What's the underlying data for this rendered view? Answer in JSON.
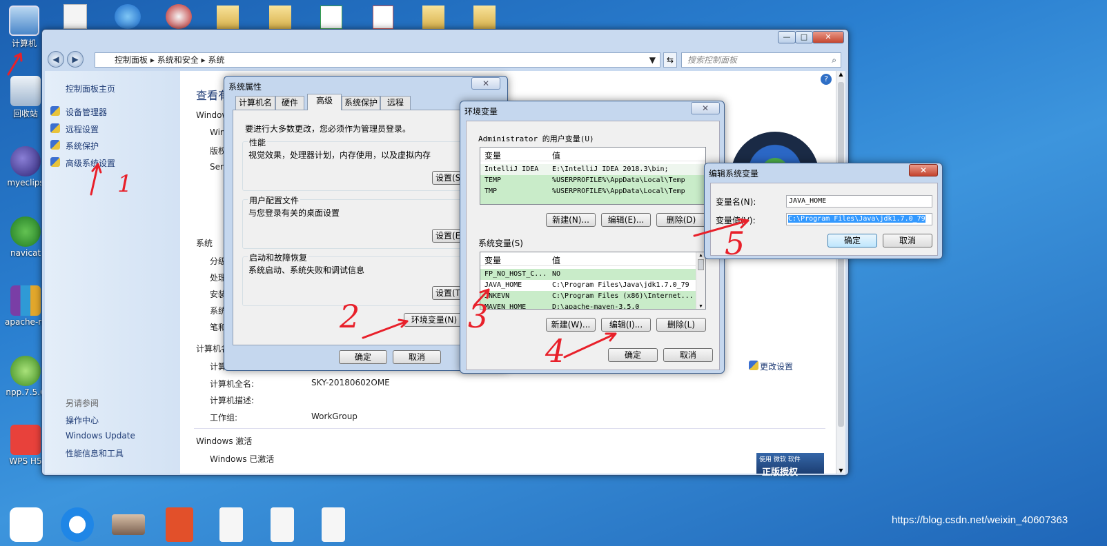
{
  "desktop": {
    "icons": [
      {
        "label": "计算机",
        "icon": "computer-icon"
      },
      {
        "label": "回收站",
        "icon": "recycle-bin-icon"
      },
      {
        "label": "myeclips",
        "icon": "eclipse-icon"
      },
      {
        "label": "navicat",
        "icon": "navicat-icon"
      },
      {
        "label": "apache-m",
        "icon": "archive-icon"
      },
      {
        "label": "npp.7.5.6",
        "icon": "notepad-icon"
      },
      {
        "label": "WPS H5",
        "icon": "wps-icon"
      }
    ],
    "watermark": "https://blog.csdn.net/weixin_40607363"
  },
  "explorer": {
    "breadcrumb": [
      "控制面板",
      "系统和安全",
      "系统"
    ],
    "search_placeholder": "搜索控制面板",
    "left_nav": {
      "home": "控制面板主页",
      "links": [
        "设备管理器",
        "远程设置",
        "系统保护",
        "高级系统设置"
      ],
      "see_also_title": "另请参阅",
      "see_also": [
        "操作中心",
        "Windows Update",
        "性能信息和工具"
      ]
    },
    "main": {
      "heading": "查看有",
      "section_windows": "Window",
      "windows_rows": [
        "Win",
        "版权",
        "Ser"
      ],
      "section_system": "系统",
      "system_rows": [
        "分级",
        "处理",
        "安装",
        "系统",
        "笔和"
      ],
      "section_computer": "计算机名",
      "computer_row": "计算",
      "full_name_label": "计算机全名:",
      "full_name_value": "SKY-20180602OME",
      "desc_label": "计算机描述:",
      "workgroup_label": "工作组:",
      "workgroup_value": "WorkGroup",
      "change_settings": "更改设置",
      "activation_section": "Windows 激活",
      "activation_status": "Windows 已激活",
      "genuine_line1": "使用 微软 软件",
      "genuine_line2": "正版授权"
    }
  },
  "sys_props": {
    "title": "系统属性",
    "tabs": [
      "计算机名",
      "硬件",
      "高级",
      "系统保护",
      "远程"
    ],
    "active_tab": "高级",
    "admin_note": "要进行大多数更改，您必须作为管理员登录。",
    "groups": [
      {
        "title": "性能",
        "desc": "视觉效果，处理器计划，内存使用，以及虚拟内存",
        "button": "设置(S"
      },
      {
        "title": "用户配置文件",
        "desc": "与您登录有关的桌面设置",
        "button": "设置(E"
      },
      {
        "title": "启动和故障恢复",
        "desc": "系统启动、系统失败和调试信息",
        "button": "设置(T"
      }
    ],
    "env_button": "环境变量(N)",
    "ok": "确定",
    "cancel": "取消"
  },
  "env_vars": {
    "title": "环境变量",
    "user_section": "Administrator 的用户变量(U)",
    "col_var": "变量",
    "col_val": "值",
    "user_rows": [
      {
        "name": "IntelliJ IDEA",
        "value": "E:\\IntelliJ IDEA 2018.3\\bin;"
      },
      {
        "name": "TEMP",
        "value": "%USERPROFILE%\\AppData\\Local\\Temp"
      },
      {
        "name": "TMP",
        "value": "%USERPROFILE%\\AppData\\Local\\Temp"
      }
    ],
    "user_buttons": [
      "新建(N)...",
      "编辑(E)...",
      "删除(D)"
    ],
    "system_section": "系统变量(S)",
    "system_rows": [
      {
        "name": "FP_NO_HOST_C...",
        "value": "NO"
      },
      {
        "name": "JAVA_HOME",
        "value": "C:\\Program Files\\Java\\jdk1.7.0_79"
      },
      {
        "name": "JNKEVN",
        "value": "C:\\Program Files (x86)\\Internet..."
      },
      {
        "name": "MAVEN_HOME",
        "value": "D:\\apache-maven-3.5.0"
      }
    ],
    "system_buttons": [
      "新建(W)...",
      "编辑(I)...",
      "删除(L)"
    ],
    "ok": "确定",
    "cancel": "取消"
  },
  "edit_var": {
    "title": "编辑系统变量",
    "name_label": "变量名(N):",
    "name_value": "JAVA_HOME",
    "value_label": "变量值(V):",
    "value_value": "C:\\Program Files\\Java\\jdk1.7.0_79",
    "ok": "确定",
    "cancel": "取消"
  },
  "annotations": [
    "1",
    "2",
    "3",
    "4",
    "5"
  ]
}
